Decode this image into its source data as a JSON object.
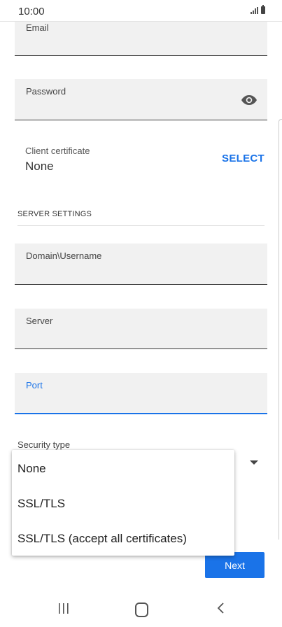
{
  "status_bar": {
    "time": "10:00"
  },
  "fields": {
    "email": {
      "label": "Email"
    },
    "password": {
      "label": "Password"
    },
    "domain_username": {
      "label": "Domain\\Username"
    },
    "server": {
      "label": "Server"
    },
    "port": {
      "label": "Port"
    }
  },
  "client_certificate": {
    "label": "Client certificate",
    "value": "None",
    "action": "SELECT"
  },
  "server_settings": {
    "title": "SERVER SETTINGS"
  },
  "security_type": {
    "label": "Security type",
    "options": [
      "None",
      "SSL/TLS",
      "SSL/TLS (accept all certificates)"
    ]
  },
  "buttons": {
    "next": "Next"
  },
  "colors": {
    "accent": "#1a73e8",
    "field_bg": "#f1f1f1"
  },
  "icons": {
    "password_toggle": "eye-icon",
    "nav_recent": "recent-apps-icon",
    "nav_home": "home-icon",
    "nav_back": "back-icon"
  }
}
